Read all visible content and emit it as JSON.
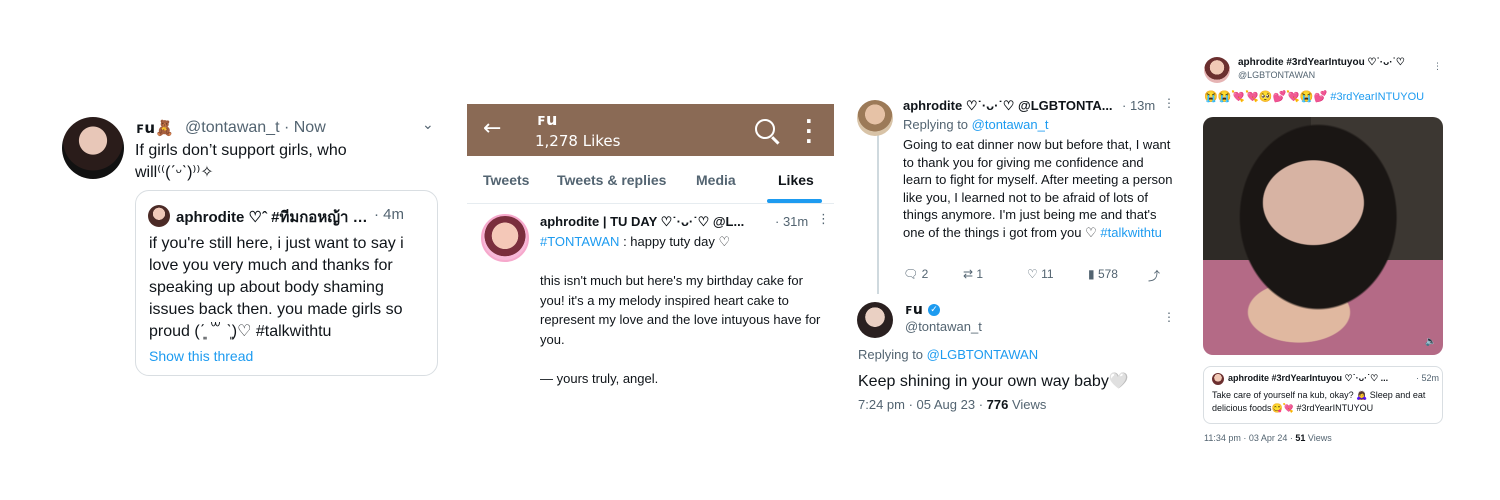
{
  "panel1": {
    "name": "ꜰu🧸",
    "handle_time": "@tontawan_t · Now",
    "text": "If girls don’t support girls, who will⁽⁽(ˊᵕˋ)⁾⁾✧",
    "quote": {
      "name": "aphrodite ♡ˆ  #ทีมกอหญ้า …",
      "time": "· 4m",
      "text": "if you're still here, i just want to say i love you very much and thanks for speaking up about body shaming issues back then. you made girls so proud (ˊ͈ ꒳ ˋ͈)♡ #talkwithtu",
      "show_thread": "Show this thread"
    }
  },
  "panel2": {
    "title": "ꜰu",
    "likes": "1,278 Likes",
    "tabs": [
      "Tweets",
      "Tweets & replies",
      "Media",
      "Likes"
    ],
    "tweet": {
      "name": "aphrodite | TU DAY ♡˙·ᴗ·˙♡ @L...",
      "time": "· 31m",
      "line1_hashtag": "#TONTAWAN",
      "line1_rest": " : happy tuty day ♡",
      "body": "this isn't much but here's my birthday cake for you! it's a my melody inspired heart cake to represent my love and the love intuyous have for you.\n\n— yours truly, angel."
    }
  },
  "panel3": {
    "tweet1": {
      "name": "aphrodite ♡˙·ᴗ·˙♡ @LGBTONTA...",
      "time": "· 13m",
      "replying_label": "Replying to ",
      "replying_handle": "@tontawan_t",
      "text": "Going to eat dinner now but before that, I want to thank you for giving me confidence and learn to fight for myself. After meeting a person like you, I learned not to be afraid of lots of things anymore. I'm just being me and that's one of the things i got from you ♡",
      "hashtag": "#talkwithtu",
      "replies": "2",
      "retweets": "1",
      "likes": "11",
      "views": "578"
    },
    "tweet2": {
      "name": "ꜰu",
      "handle": "@tontawan_t",
      "replying_label": "Replying to ",
      "replying_handle": "@LGBTONTAWAN",
      "text": "Keep shining in your own way baby🤍",
      "meta_time": "7:24 pm · 05 Aug 23 · ",
      "meta_views_num": "776",
      "meta_views_label": " Views"
    }
  },
  "panel4": {
    "name": "aphrodite #3rdYearIntuyou ♡˙·ᴗ·˙♡",
    "handle": "@LGBTONTAWAN",
    "emojis": "😭😭💘💘🥺💕💘😭💕 ",
    "hashtag": "#3rdYearINTUYOU",
    "quote": {
      "name": "aphrodite #3rdYearIntuyou ♡˙·ᴗ·˙♡ ...",
      "time": "· 52m",
      "text": "Take care of yourself na kub, okay? 🙇‍♀️ Sleep and eat delicious foods😋💘 #3rdYearINTUYOU"
    },
    "meta_time": "11:34 pm · 03 Apr 24 · ",
    "meta_views_num": "51",
    "meta_views_label": " Views"
  }
}
